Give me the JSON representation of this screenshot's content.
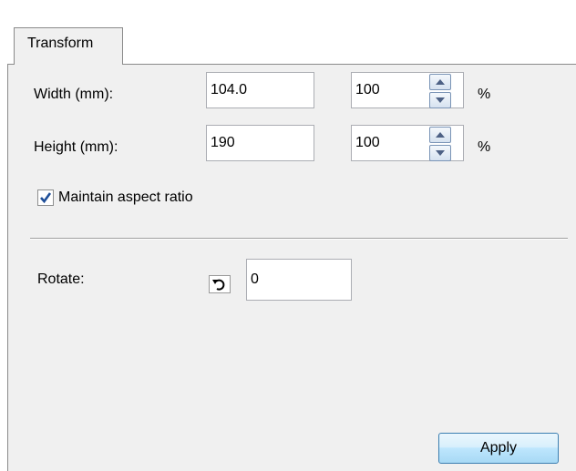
{
  "tabs": [
    {
      "label": "Transform",
      "active": true
    }
  ],
  "width": {
    "label": "Width (mm):",
    "value": "104.0",
    "percent": "100",
    "unit": "%"
  },
  "height": {
    "label": "Height (mm):",
    "value": "190",
    "percent": "100",
    "unit": "%"
  },
  "aspect": {
    "label": "Maintain aspect ratio",
    "checked": true
  },
  "rotate": {
    "label": "Rotate:",
    "value": "0",
    "icon": "rotate-left-icon"
  },
  "apply_label": "Apply",
  "colors": {
    "panel_bg": "#f0f0f0",
    "button_border": "#3c7fb1",
    "check_mark": "#1e4e98"
  }
}
